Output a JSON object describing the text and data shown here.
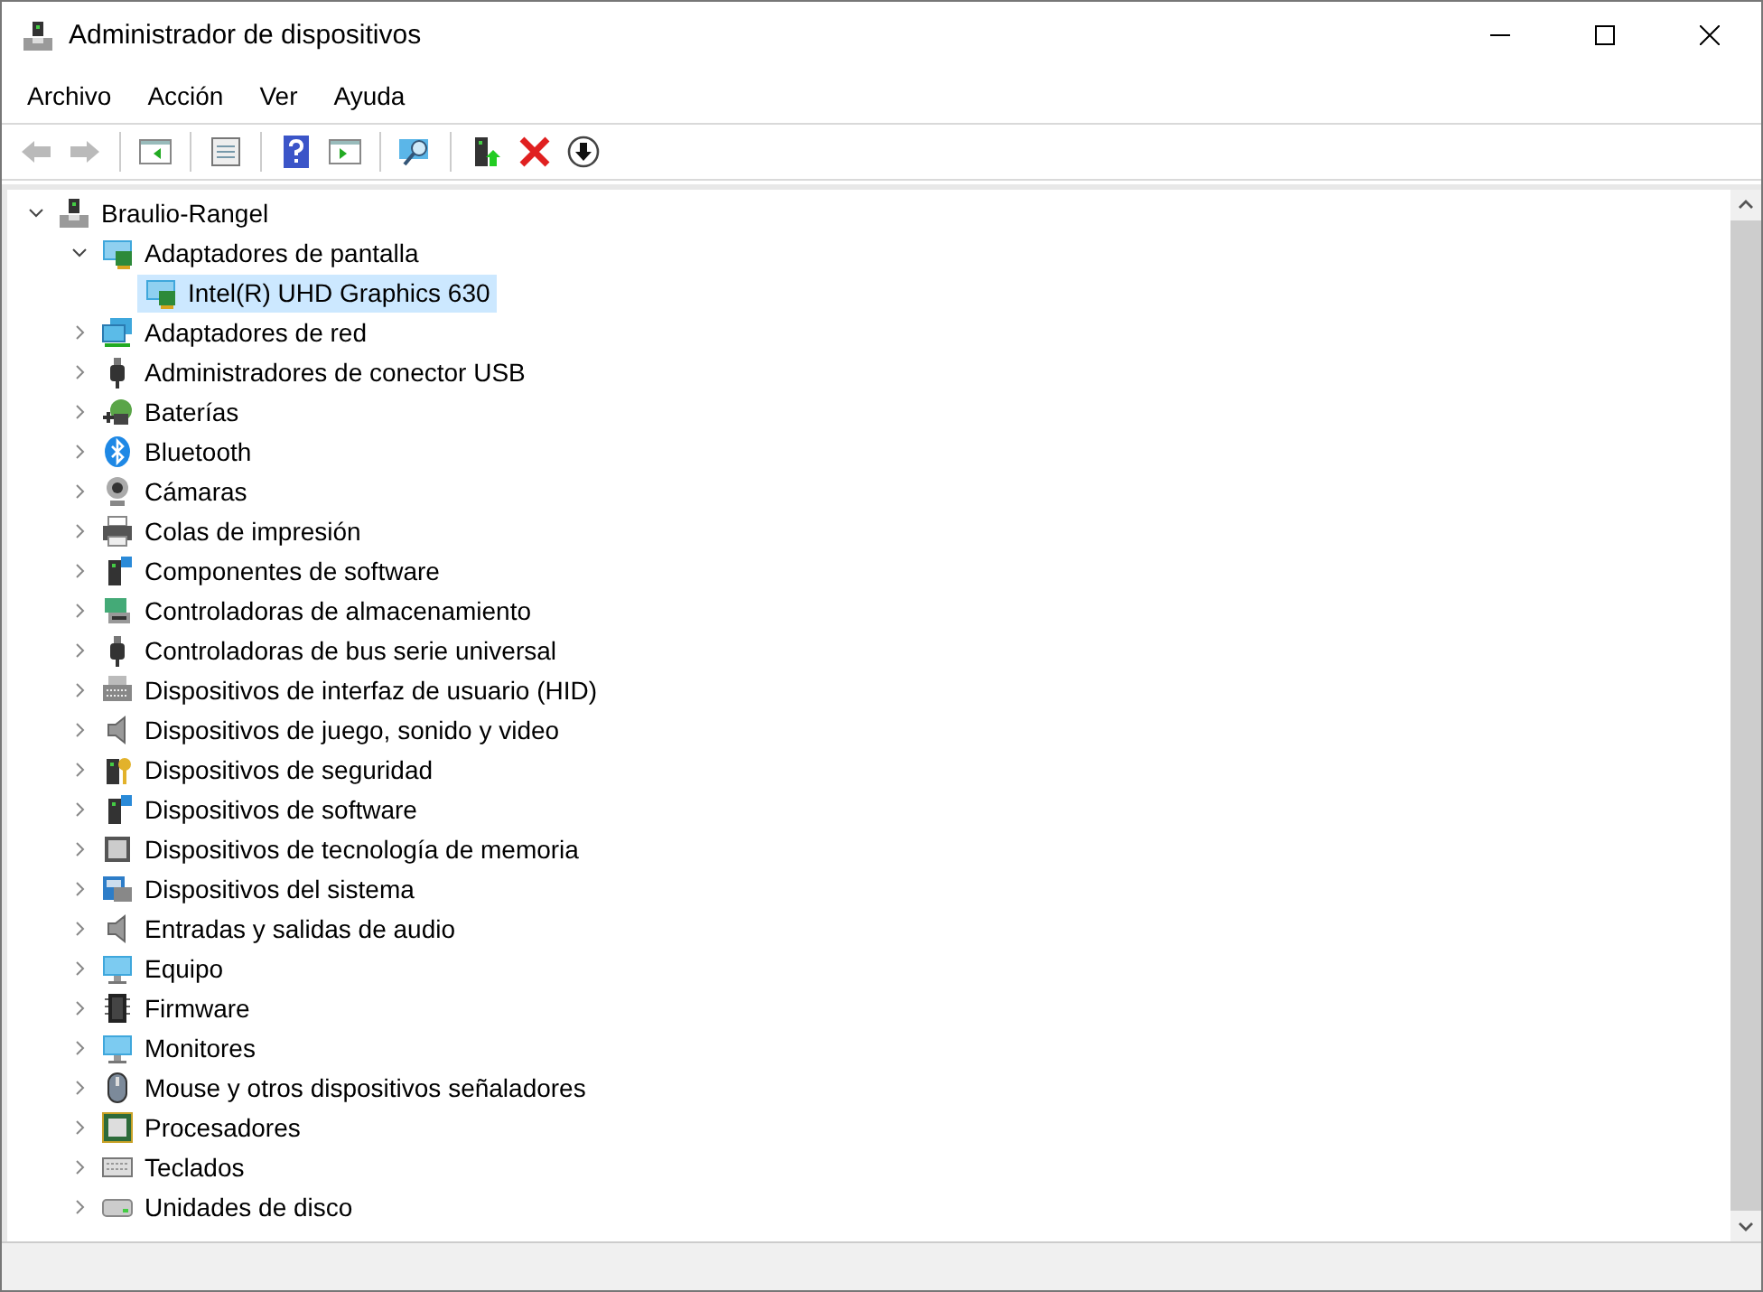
{
  "window": {
    "title": "Administrador de dispositivos"
  },
  "menu": [
    "Archivo",
    "Acción",
    "Ver",
    "Ayuda"
  ],
  "toolbar": [
    {
      "kind": "back",
      "disabled": true
    },
    {
      "kind": "forward",
      "disabled": true
    },
    {
      "kind": "console-tree",
      "disabled": false
    },
    {
      "kind": "properties",
      "disabled": false
    },
    {
      "kind": "help",
      "disabled": false
    },
    {
      "kind": "action-pane",
      "disabled": false
    },
    {
      "kind": "scan",
      "disabled": false
    },
    {
      "kind": "update",
      "disabled": false
    },
    {
      "kind": "uninstall",
      "disabled": false
    },
    {
      "kind": "disable",
      "disabled": false
    }
  ],
  "tree": [
    {
      "label": "Braulio-Rangel",
      "kind": "computer",
      "expanded": true,
      "selected": false,
      "children": [
        {
          "label": "Adaptadores de pantalla",
          "kind": "display",
          "expanded": true,
          "selected": false,
          "children": [
            {
              "label": "Intel(R) UHD Graphics 630",
              "kind": "display-device",
              "selected": true
            }
          ]
        },
        {
          "label": "Adaptadores de red",
          "kind": "network",
          "expanded": false,
          "selected": false
        },
        {
          "label": "Administradores de conector USB",
          "kind": "usb",
          "expanded": false,
          "selected": false
        },
        {
          "label": "Baterías",
          "kind": "battery",
          "expanded": false,
          "selected": false
        },
        {
          "label": "Bluetooth",
          "kind": "bluetooth",
          "expanded": false,
          "selected": false
        },
        {
          "label": "Cámaras",
          "kind": "camera",
          "expanded": false,
          "selected": false
        },
        {
          "label": "Colas de impresión",
          "kind": "printer",
          "expanded": false,
          "selected": false
        },
        {
          "label": "Componentes de software",
          "kind": "software",
          "expanded": false,
          "selected": false
        },
        {
          "label": "Controladoras de almacenamiento",
          "kind": "storage",
          "expanded": false,
          "selected": false
        },
        {
          "label": "Controladoras de bus serie universal",
          "kind": "usb",
          "expanded": false,
          "selected": false
        },
        {
          "label": "Dispositivos de interfaz de usuario (HID)",
          "kind": "hid",
          "expanded": false,
          "selected": false
        },
        {
          "label": "Dispositivos de juego, sonido y video",
          "kind": "speaker",
          "expanded": false,
          "selected": false
        },
        {
          "label": "Dispositivos de seguridad",
          "kind": "security",
          "expanded": false,
          "selected": false
        },
        {
          "label": "Dispositivos de software",
          "kind": "software",
          "expanded": false,
          "selected": false
        },
        {
          "label": "Dispositivos de tecnología de memoria",
          "kind": "memory",
          "expanded": false,
          "selected": false
        },
        {
          "label": "Dispositivos del sistema",
          "kind": "system",
          "expanded": false,
          "selected": false
        },
        {
          "label": "Entradas y salidas de audio",
          "kind": "speaker",
          "expanded": false,
          "selected": false
        },
        {
          "label": "Equipo",
          "kind": "monitor",
          "expanded": false,
          "selected": false
        },
        {
          "label": "Firmware",
          "kind": "chip",
          "expanded": false,
          "selected": false
        },
        {
          "label": "Monitores",
          "kind": "monitor",
          "expanded": false,
          "selected": false
        },
        {
          "label": "Mouse y otros dispositivos señaladores",
          "kind": "mouse",
          "expanded": false,
          "selected": false
        },
        {
          "label": "Procesadores",
          "kind": "processor",
          "expanded": false,
          "selected": false
        },
        {
          "label": "Teclados",
          "kind": "keyboard",
          "expanded": false,
          "selected": false
        },
        {
          "label": "Unidades de disco",
          "kind": "disk",
          "expanded": false,
          "selected": false
        }
      ]
    }
  ]
}
